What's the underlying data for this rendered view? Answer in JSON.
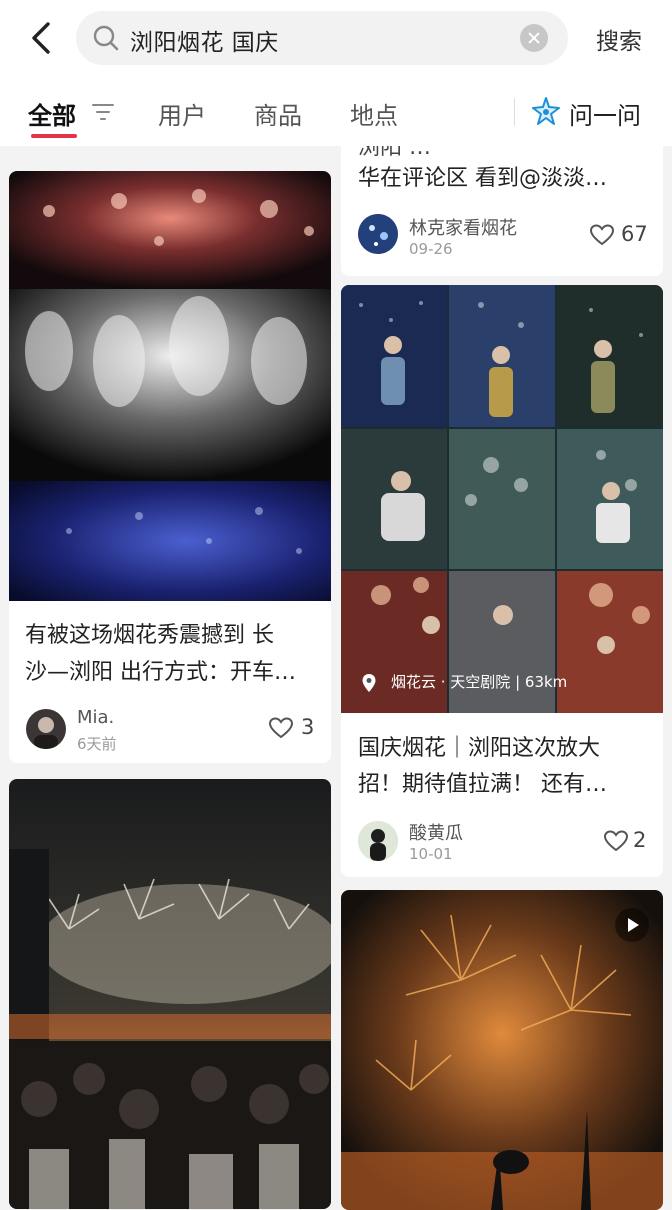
{
  "search": {
    "query": "浏阳烟花 国庆",
    "button": "搜索"
  },
  "tabs": {
    "all": "全部",
    "users": "用户",
    "goods": "商品",
    "places": "地点",
    "ask": "问一问"
  },
  "cards": {
    "left1": {
      "title_line1": "有被这场烟花秀震撼到 长",
      "title_line2": "沙—浏阳 出行方式：开车…",
      "author": "Mia.",
      "date": "6天前",
      "likes": "3"
    },
    "right0": {
      "title_line1": "浏阳 …",
      "title_line2": "华在评论区 看到@淡淡…",
      "author": "林克家看烟花",
      "date": "09-26",
      "likes": "67"
    },
    "right1": {
      "location": "烟花云 · 天空剧院 | 63km",
      "title_line1": "国庆烟花｜浏阳这次放大",
      "title_line2": "招！期待值拉满！ 还有…",
      "author": "酸黄瓜",
      "date": "10-01",
      "likes": "2"
    }
  },
  "icons": {
    "back": "chevron-left-icon",
    "search": "magnifier-icon",
    "clear": "close-circle-icon",
    "filter": "filter-lines-icon",
    "ask": "sparkle-star-icon",
    "like": "heart-outline-icon",
    "location": "location-pin-icon",
    "video": "play-icon"
  },
  "colors": {
    "accent": "#e2334a",
    "ask_star": "#1e8fd8",
    "bg": "#f3f3f3"
  }
}
